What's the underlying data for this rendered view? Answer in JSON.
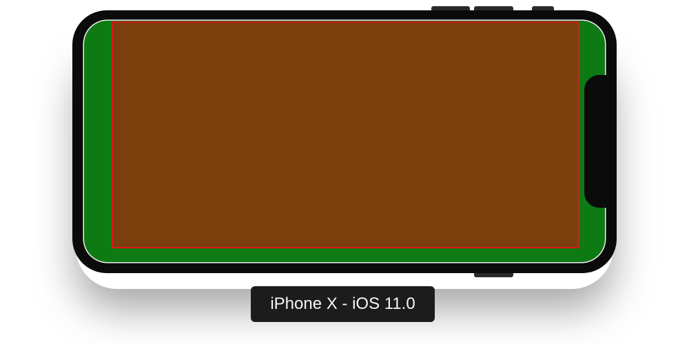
{
  "simulator": {
    "device_label": "iPhone X - iOS 11.0"
  },
  "colors": {
    "device_bezel": "#0b0b0b",
    "screen_background": "#0e7a14",
    "safe_area_fill": "#7b3f0d",
    "safe_area_border": "#e0161b",
    "home_indicator": "#3a3a3a",
    "label_background": "#1c1c1c",
    "label_text": "#f5f5f5"
  }
}
